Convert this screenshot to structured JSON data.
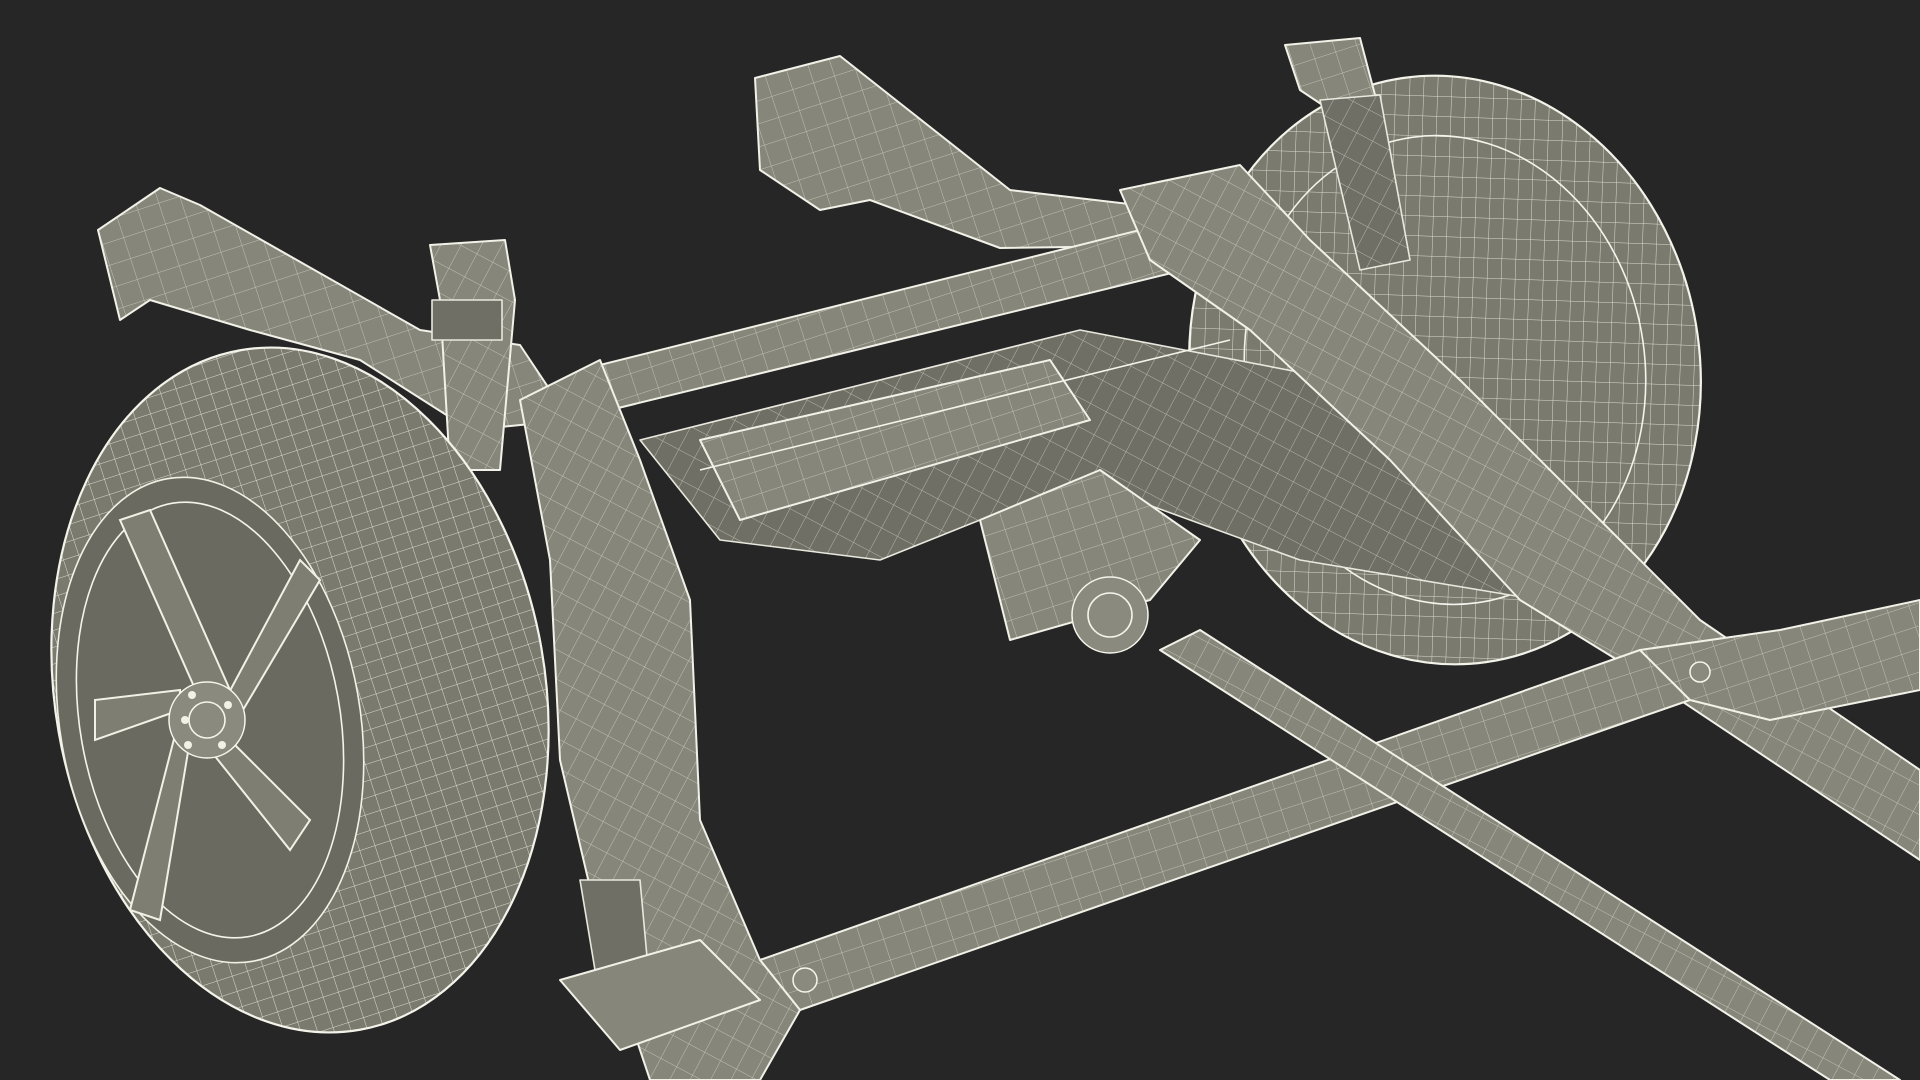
{
  "scene": {
    "background": "#262626",
    "mesh_fill": "#86867a",
    "wire_color": "#f1f1e8"
  }
}
